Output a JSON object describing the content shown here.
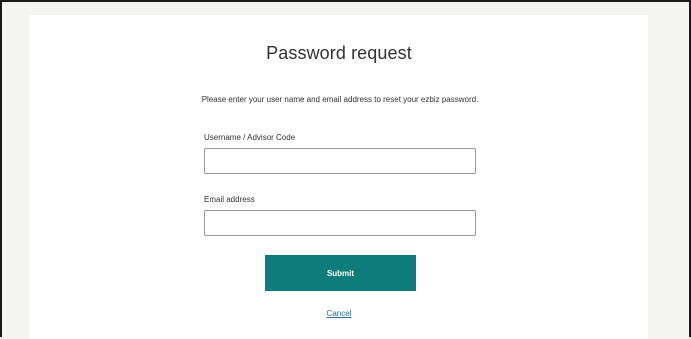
{
  "page": {
    "title": "Password request",
    "intro_text": "Please enter your user name and email address to reset your ezbiz password."
  },
  "form": {
    "username": {
      "label": "Username / Advisor Code",
      "value": "",
      "placeholder": ""
    },
    "email": {
      "label": "Email address",
      "value": "",
      "placeholder": ""
    },
    "submit_label": "Submit",
    "cancel_label": "Cancel"
  },
  "colors": {
    "submit_background": "#0f7c7c",
    "link": "#2b6b99",
    "page_background": "#f4f4f2",
    "card_background": "#ffffff"
  }
}
